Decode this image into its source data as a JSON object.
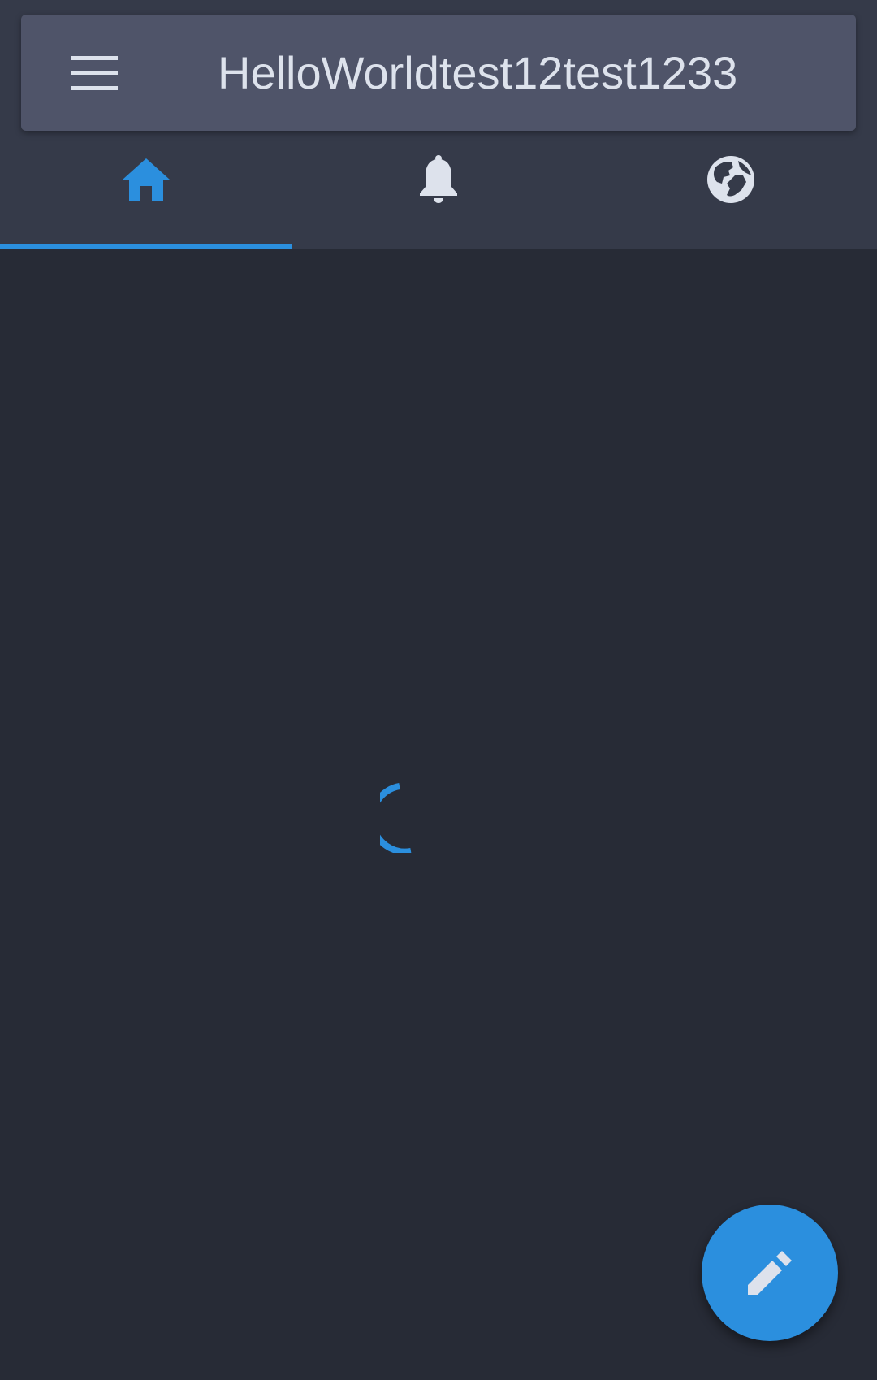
{
  "app_bar": {
    "title": "HelloWorldtest12test1233",
    "menu_icon": "menu-icon"
  },
  "tabs": [
    {
      "icon": "home-icon",
      "selected": true
    },
    {
      "icon": "bell-icon",
      "selected": false
    },
    {
      "icon": "globe-icon",
      "selected": false
    }
  ],
  "fab": {
    "icon": "pencil-icon"
  },
  "colors": {
    "background": "#272b36",
    "header": "#353a49",
    "app_bar": "#4f5469",
    "accent": "#2b8fde",
    "icon_light": "#dde2ec"
  }
}
